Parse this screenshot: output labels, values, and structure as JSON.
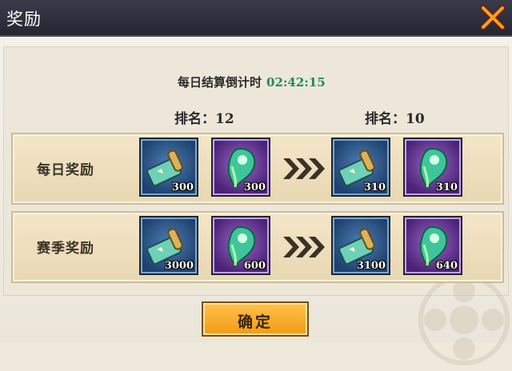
{
  "window": {
    "title": "奖励"
  },
  "icons": {
    "close": "close-x-icon",
    "scroll": "scroll-icon",
    "jade": "magatama-icon",
    "arrows": "triple-chevron-right-icon"
  },
  "timer": {
    "label": "每日结算倒计时",
    "value": "02:42:15"
  },
  "ranks": {
    "current": "排名：12",
    "next": "排名：10"
  },
  "rows": [
    {
      "label": "每日奖励",
      "current": [
        "300",
        "300"
      ],
      "next": [
        "310",
        "310"
      ]
    },
    {
      "label": "赛季奖励",
      "current": [
        "3000",
        "600"
      ],
      "next": [
        "3100",
        "640"
      ]
    }
  ],
  "confirm_label": "确定",
  "colors": {
    "timer_value": "#1b8d55",
    "button": "#f29b17",
    "header": "#2f2f3d"
  }
}
